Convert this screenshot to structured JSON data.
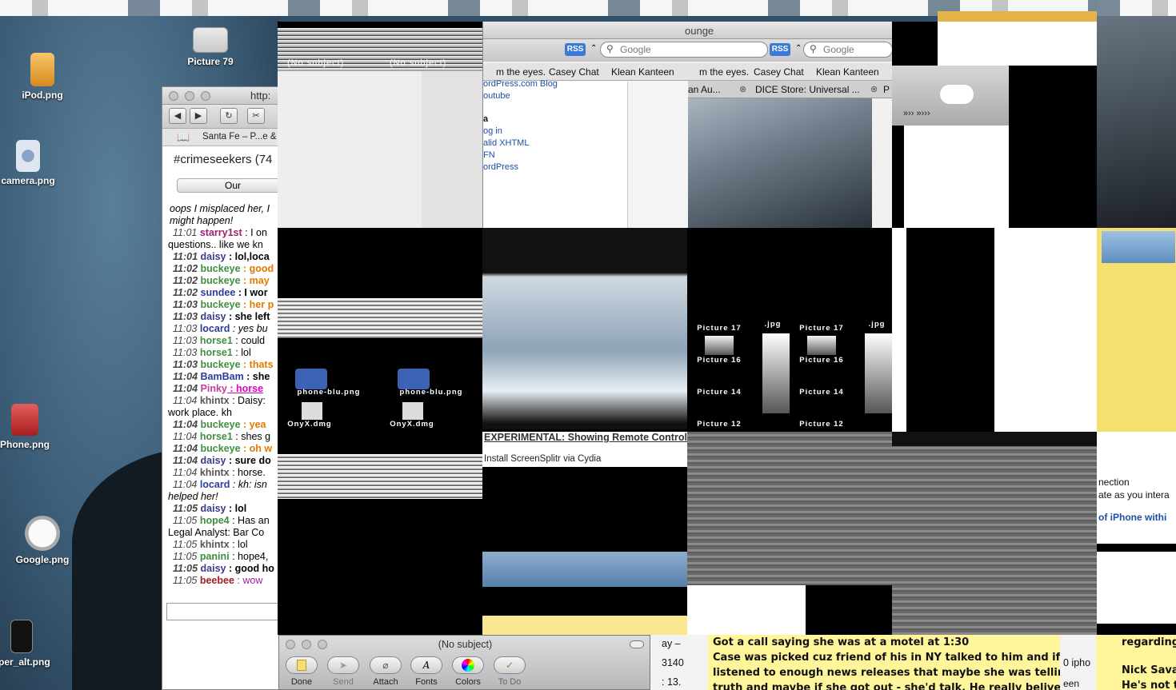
{
  "desktop": {
    "icons": [
      {
        "label": "Picture 79",
        "icon": "picture-icon"
      },
      {
        "label": "iPod.png",
        "icon": "ipod-file-icon"
      },
      {
        "label": "camera.png",
        "icon": "camera-file-icon"
      },
      {
        "label": "Phone.png",
        "icon": "phone-file-icon"
      },
      {
        "label": "Google.png",
        "icon": "google-file-icon"
      },
      {
        "label": "aper_alt.png",
        "icon": "wallpaper-file-icon"
      }
    ]
  },
  "chat_window": {
    "url_fragment": "http:",
    "bookmark": "Santa Fe – P...e &",
    "channel": "#crimeseekers (74",
    "tab_label": "Our",
    "intro_lines": [
      "oops I misplaced her, I",
      "might happen!"
    ],
    "messages": [
      {
        "time": "11:01",
        "nick": "starry1st",
        "color": "#a0206e",
        "text": ": I on",
        "bold": false
      },
      {
        "time": "",
        "nick": "",
        "color": "#000",
        "text": "questions.. like we kn",
        "bold": false
      },
      {
        "time": "11:01",
        "nick": "daisy",
        "color": "#3a3c8c",
        "text": ": lol,loca",
        "bold": true
      },
      {
        "time": "11:02",
        "nick": "buckeye",
        "color": "#3f8f3f",
        "text": ": good",
        "bold": true,
        "textcolor": "#e07b00"
      },
      {
        "time": "11:02",
        "nick": "buckeye",
        "color": "#3f8f3f",
        "text": ": may",
        "bold": true,
        "textcolor": "#e07b00"
      },
      {
        "time": "11:02",
        "nick": "sundee",
        "color": "#2b3c9c",
        "text": ": I wor",
        "bold": true
      },
      {
        "time": "11:03",
        "nick": "buckeye",
        "color": "#3f8f3f",
        "text": ": her p",
        "bold": true,
        "textcolor": "#e07b00"
      },
      {
        "time": "11:03",
        "nick": "daisy",
        "color": "#3a3c8c",
        "text": ": she left",
        "bold": true
      },
      {
        "time": "11:03",
        "nick": "locard",
        "color": "#2b3c9c",
        "text": ": yes bu",
        "bold": false,
        "italic": true
      },
      {
        "time": "11:03",
        "nick": "horse1",
        "color": "#3f8f3f",
        "text": ": could",
        "bold": false
      },
      {
        "time": "11:03",
        "nick": "horse1",
        "color": "#3f8f3f",
        "text": ": lol",
        "bold": false
      },
      {
        "time": "11:03",
        "nick": "buckeye",
        "color": "#3f8f3f",
        "text": ": thats",
        "bold": true,
        "textcolor": "#e07b00"
      },
      {
        "time": "11:04",
        "nick": "BamBam",
        "color": "#2b3c9c",
        "text": ": she",
        "bold": true
      },
      {
        "time": "11:04",
        "nick": "Pinky",
        "color": "#c040a0",
        "text": ": horse",
        "bold": true,
        "textcolor": "#e000c0"
      },
      {
        "time": "11:04",
        "nick": "khintx",
        "color": "#555",
        "text": ": Daisy:",
        "bold": false
      },
      {
        "time": "",
        "nick": "",
        "color": "#000",
        "text": "work place.   kh",
        "bold": false
      },
      {
        "time": "11:04",
        "nick": "buckeye",
        "color": "#3f8f3f",
        "text": ": yea",
        "bold": true,
        "textcolor": "#e07b00"
      },
      {
        "time": "11:04",
        "nick": "horse1",
        "color": "#3f8f3f",
        "text": ": shes g",
        "bold": false
      },
      {
        "time": "11:04",
        "nick": "buckeye",
        "color": "#3f8f3f",
        "text": ": oh w",
        "bold": true,
        "textcolor": "#e07b00"
      },
      {
        "time": "11:04",
        "nick": "daisy",
        "color": "#3a3c8c",
        "text": ": sure do",
        "bold": true
      },
      {
        "time": "11:04",
        "nick": "khintx",
        "color": "#555",
        "text": ": horse.",
        "bold": false
      },
      {
        "time": "11:04",
        "nick": "locard",
        "color": "#2b3c9c",
        "text": ": kh: isn",
        "bold": false,
        "italic": true
      },
      {
        "time": "",
        "nick": "",
        "color": "#000",
        "text": "helped her!",
        "bold": false,
        "italic": true
      },
      {
        "time": "11:05",
        "nick": "daisy",
        "color": "#3a3c8c",
        "text": ": lol",
        "bold": true
      },
      {
        "time": "11:05",
        "nick": "hope4",
        "color": "#3f8f3f",
        "text": ": Has an",
        "bold": false
      },
      {
        "time": "",
        "nick": "",
        "color": "#000",
        "text": "Legal Analyst: Bar Co",
        "bold": false
      },
      {
        "time": "11:05",
        "nick": "khintx",
        "color": "#555",
        "text": ": lol",
        "bold": false
      },
      {
        "time": "11:05",
        "nick": "panini",
        "color": "#3f8f3f",
        "text": ": hope4,",
        "bold": false
      },
      {
        "time": "11:05",
        "nick": "daisy",
        "color": "#3a3c8c",
        "text": ": good ho",
        "bold": true
      },
      {
        "time": "11:05",
        "nick": "beebee",
        "color": "#a02020",
        "text": ": wow",
        "bold": false,
        "textcolor": "#a020a0"
      }
    ]
  },
  "mail_pane": {
    "subject_1": "(No subject)",
    "subject_2": "(No subject)"
  },
  "browser": {
    "title": "ounge",
    "rss": "RSS",
    "search_placeholder": "Google",
    "bookmarks": [
      "m the eyes.",
      "Casey Chat",
      "Klean Kanteen"
    ],
    "tabs": [
      "an Au...",
      "DICE Store: Universal ...",
      "P"
    ],
    "sidebar_links": [
      "ordPress.com Blog",
      "outube",
      "a",
      "og in",
      "alid XHTML",
      "FN",
      "ordPress"
    ],
    "article_heading": "EXPERIMENTAL: Showing Remote Control",
    "article_line": "Install ScreenSplitr via Cydia"
  },
  "thumbs": {
    "files": [
      "phone-blu.png",
      "phone-blu.png",
      "OnyX.dmg",
      "OnyX.dmg"
    ],
    "pictures": [
      "Picture 17",
      "Picture 17",
      "Picture 16",
      "Picture 16",
      "Picture 14",
      "Picture 14",
      "Picture 12",
      "Picture 12"
    ],
    "jpg": ".jpg"
  },
  "mail_compose": {
    "title": "(No subject)",
    "buttons": [
      "Done",
      "Send",
      "Attach",
      "Fonts",
      "Colors",
      "To Do"
    ]
  },
  "sticky_note": {
    "lines": [
      "Got a call saying she was at a motel at 1:30",
      "Case was picked cuz friend of his in NY talked to him and if he",
      "listened to enough news releases that maybe she was telling",
      "truth and maybe if she got out - she'd talk.  He really belived"
    ]
  },
  "right_fragments": {
    "connection": "nection",
    "interact": "ate as you intera",
    "iphone": "of iPhone withi",
    "regarding": "regarding v",
    "nick": "Nick Savag",
    "bottom": "He's not te"
  },
  "misc_fragments": {
    "day": "ay –",
    "num": "3140",
    "thirteen": ": 13.",
    "iphone": "0 ipho",
    "een": "een"
  }
}
